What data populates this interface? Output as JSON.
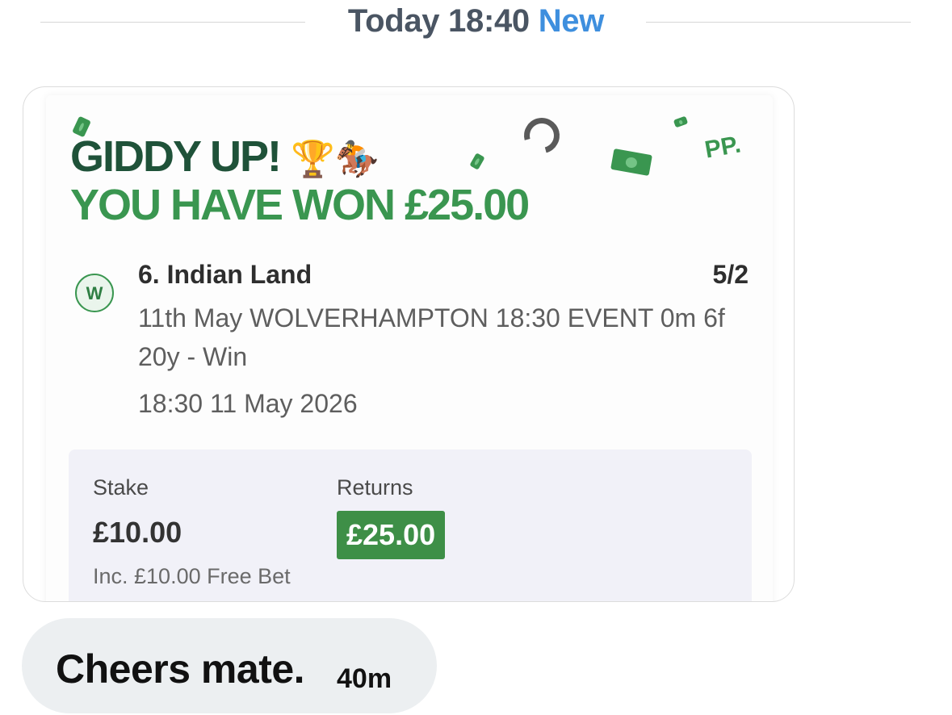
{
  "separator": {
    "time_text": "Today 18:40",
    "new_text": "New"
  },
  "bet_card": {
    "headline": "GIDDY UP!",
    "headline_emojis": "🏆🏇",
    "win_text": "YOU HAVE WON £25.00",
    "brand_logo_text": "PP.",
    "result_badge": "W",
    "selection": "6. Indian Land",
    "odds": "5/2",
    "event_description": "11th May WOLVERHAMPTON 18:30 EVENT 0m 6f 20y - Win",
    "event_datetime": "18:30 11 May 2026",
    "stake_label": "Stake",
    "stake_value": "£10.00",
    "free_bet_note": "Inc. £10.00 Free Bet",
    "returns_label": "Returns",
    "returns_value": "£25.00",
    "colors": {
      "dark_green": "#1f5239",
      "brand_green": "#3a9650",
      "returns_badge": "#3e8f47"
    },
    "decorations": [
      "cash-note-icon",
      "horseshoe-icon"
    ]
  },
  "reply": {
    "text": "Cheers mate.",
    "time": "40m"
  }
}
